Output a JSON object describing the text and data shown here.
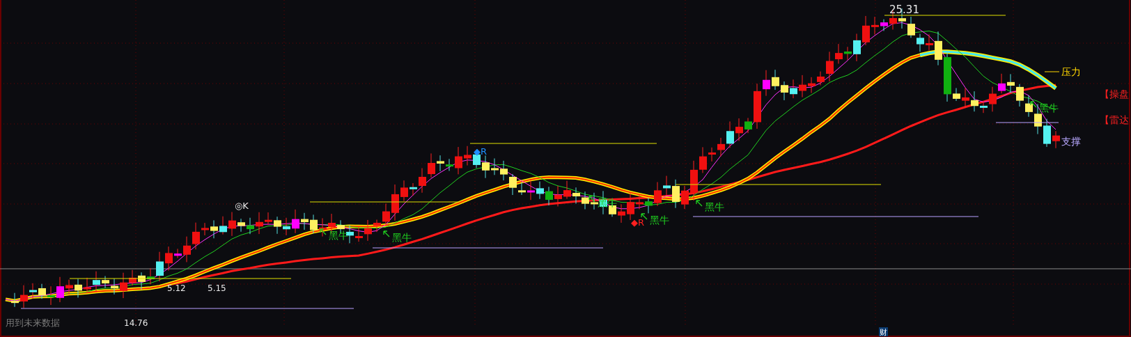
{
  "price_marks": [
    {
      "text": "25.31"
    },
    {
      "text": "5.12"
    },
    {
      "text": "5.15"
    },
    {
      "text": "14.76"
    }
  ],
  "signals": [
    {
      "text": "◎K",
      "color": "#e8e8e8"
    },
    {
      "text": "◆R",
      "color": "#1e90ff"
    },
    {
      "text": "◆R",
      "color": "#ff2020"
    }
  ],
  "bull_labels": [
    {
      "text": "黑牛"
    },
    {
      "text": "黑牛"
    },
    {
      "text": "黑牛"
    },
    {
      "text": "黑牛"
    },
    {
      "text": "黑牛"
    },
    {
      "text": "黑牛"
    }
  ],
  "line_labels": [
    {
      "text": "压力",
      "color": "#ffd700"
    },
    {
      "text": "【操盘",
      "color": "#ff2020"
    },
    {
      "text": "【雷达",
      "color": "#ff2020"
    },
    {
      "text": "支撑",
      "color": "#b8a8ff"
    }
  ],
  "footer": {
    "note": "用到未来数据",
    "badge": "财"
  }
}
